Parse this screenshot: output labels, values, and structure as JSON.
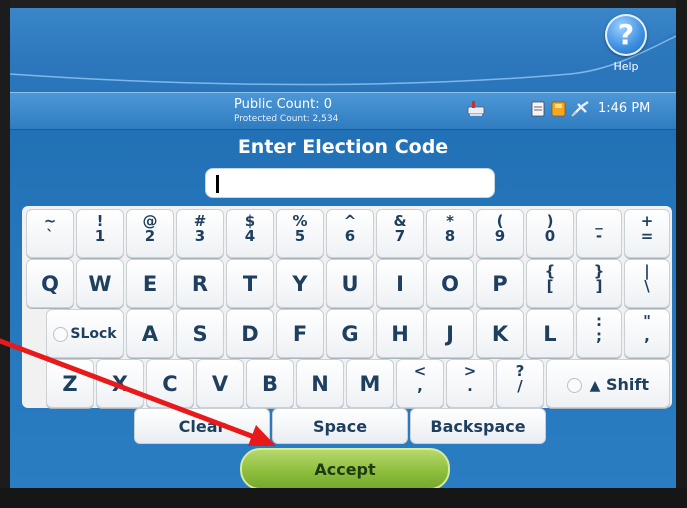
{
  "help": {
    "label": "Help",
    "glyph": "?"
  },
  "status": {
    "public_count": "Public Count: 0",
    "protected_count": "Protected Count: 2,534",
    "time": "1:46 PM"
  },
  "title": "Enter Election Code",
  "code_input": {
    "value": ""
  },
  "keys": {
    "row1": [
      {
        "top": "~",
        "bottom": "`"
      },
      {
        "top": "!",
        "bottom": "1"
      },
      {
        "top": "@",
        "bottom": "2"
      },
      {
        "top": "#",
        "bottom": "3"
      },
      {
        "top": "$",
        "bottom": "4"
      },
      {
        "top": "%",
        "bottom": "5"
      },
      {
        "top": "^",
        "bottom": "6"
      },
      {
        "top": "&",
        "bottom": "7"
      },
      {
        "top": "*",
        "bottom": "8"
      },
      {
        "top": "(",
        "bottom": "9"
      },
      {
        "top": ")",
        "bottom": "0"
      },
      {
        "top": "_",
        "bottom": "-"
      },
      {
        "top": "+",
        "bottom": "="
      }
    ],
    "row2": [
      "Q",
      "W",
      "E",
      "R",
      "T",
      "Y",
      "U",
      "I",
      "O",
      "P"
    ],
    "row2_sym": [
      {
        "top": "{",
        "bottom": "["
      },
      {
        "top": "}",
        "bottom": "]"
      },
      {
        "top": "|",
        "bottom": "\\"
      }
    ],
    "row3": [
      "A",
      "S",
      "D",
      "F",
      "G",
      "H",
      "J",
      "K",
      "L"
    ],
    "row3_sym": [
      {
        "top": ":",
        "bottom": ";"
      },
      {
        "top": "\"",
        "bottom": ","
      }
    ],
    "slock": "SLock",
    "row4": [
      "Z",
      "X",
      "C",
      "V",
      "B",
      "N",
      "M"
    ],
    "row4_sym": [
      {
        "top": "<",
        "bottom": ","
      },
      {
        "top": ">",
        "bottom": "."
      },
      {
        "top": "?",
        "bottom": "/"
      }
    ],
    "shift": "Shift",
    "clear": "Clear",
    "space": "Space",
    "backspace": "Backspace"
  },
  "accept": "Accept",
  "colors": {
    "accent": "#8fbf3e",
    "screen": "#2474b9",
    "annotation_arrow": "#e8191a"
  }
}
